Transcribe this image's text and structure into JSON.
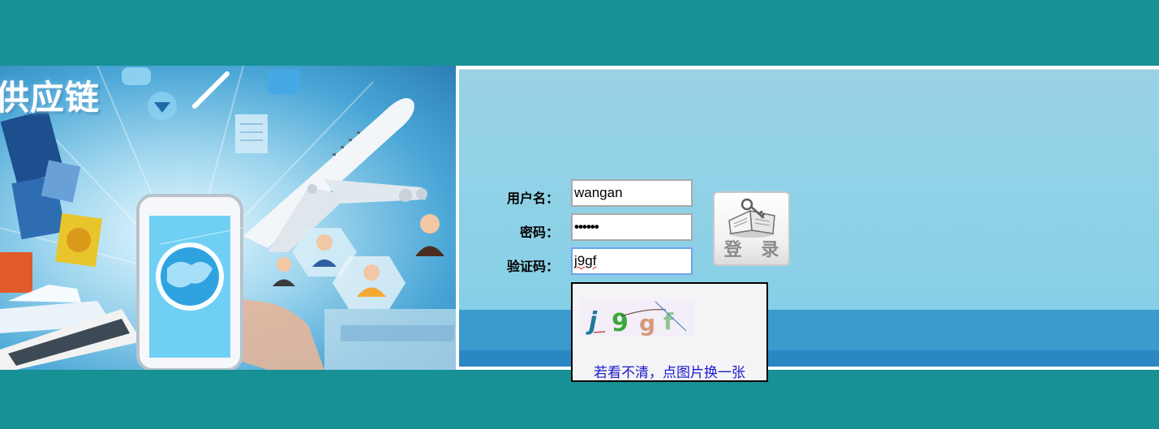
{
  "banner": {
    "title": "供应链"
  },
  "form": {
    "username_label": "用户名：",
    "username_value": "wangan",
    "password_label": "密码：",
    "password_value": "••••••",
    "captcha_label": "验证码：",
    "captcha_value": "j9gf"
  },
  "login": {
    "label": "登 录"
  },
  "captcha_popup": {
    "image_text": "j9gf",
    "hint": "若看不清，点图片换一张"
  },
  "colors": {
    "page_background": "#179194",
    "panel_background": "#92d2e7",
    "panel_band": "#3a9bcc",
    "hint_text": "#1a1acc"
  }
}
